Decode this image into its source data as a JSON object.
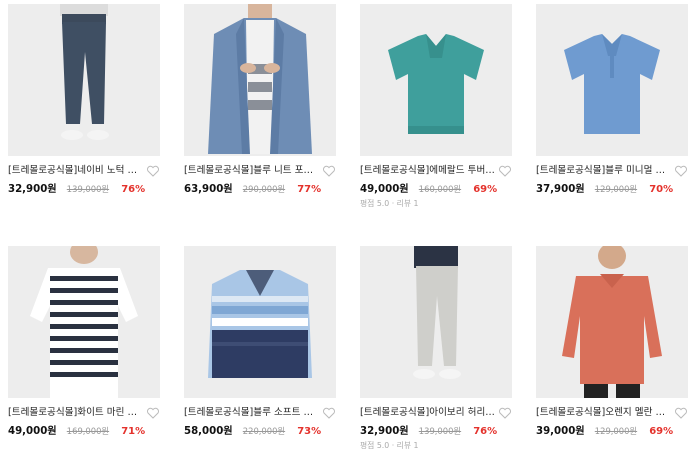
{
  "products": [
    {
      "title": "[트레몰로공식몰]네이비 노턱 허리밴딩 슬림 팬츠",
      "price": "32,900원",
      "original": "139,000원",
      "discount": "76%",
      "meta": ""
    },
    {
      "title": "[트레몰로공식몰]블루 니트 포인트 점퍼",
      "price": "63,900원",
      "original": "290,000원",
      "discount": "77%",
      "meta": ""
    },
    {
      "title": "[트레몰로공식몰]에메랄드 투버튼 반팔 티셔츠",
      "price": "49,000원",
      "original": "160,000원",
      "discount": "69%",
      "meta": "평점 5.0 · 리뷰 1"
    },
    {
      "title": "[트레몰로공식몰]블루 미니멀 기하학 반팔 티셔츠",
      "price": "37,900원",
      "original": "129,000원",
      "discount": "70%",
      "meta": ""
    },
    {
      "title": "[트레몰로공식몰]화이트 마린 스트라이프 티셔츠",
      "price": "49,000원",
      "original": "169,000원",
      "discount": "71%",
      "meta": ""
    },
    {
      "title": "[트레몰로공식몰]블루 소프트 레이어드 니트",
      "price": "58,000원",
      "original": "220,000원",
      "discount": "73%",
      "meta": ""
    },
    {
      "title": "[트레몰로공식몰]아이보리 허리밴딩 슬림 팬츠",
      "price": "32,900원",
      "original": "139,000원",
      "discount": "76%",
      "meta": "평점 5.0 · 리뷰 1"
    },
    {
      "title": "[트레몰로공식몰]오렌지 멜란 캐주얼 카라 티셔츠",
      "price": "39,000원",
      "original": "129,000원",
      "discount": "69%",
      "meta": ""
    }
  ],
  "colors": {
    "discount": "#e4322c",
    "thumb_bg": "#ededed"
  },
  "icons": {
    "wishlist": "heart-outline-icon"
  }
}
